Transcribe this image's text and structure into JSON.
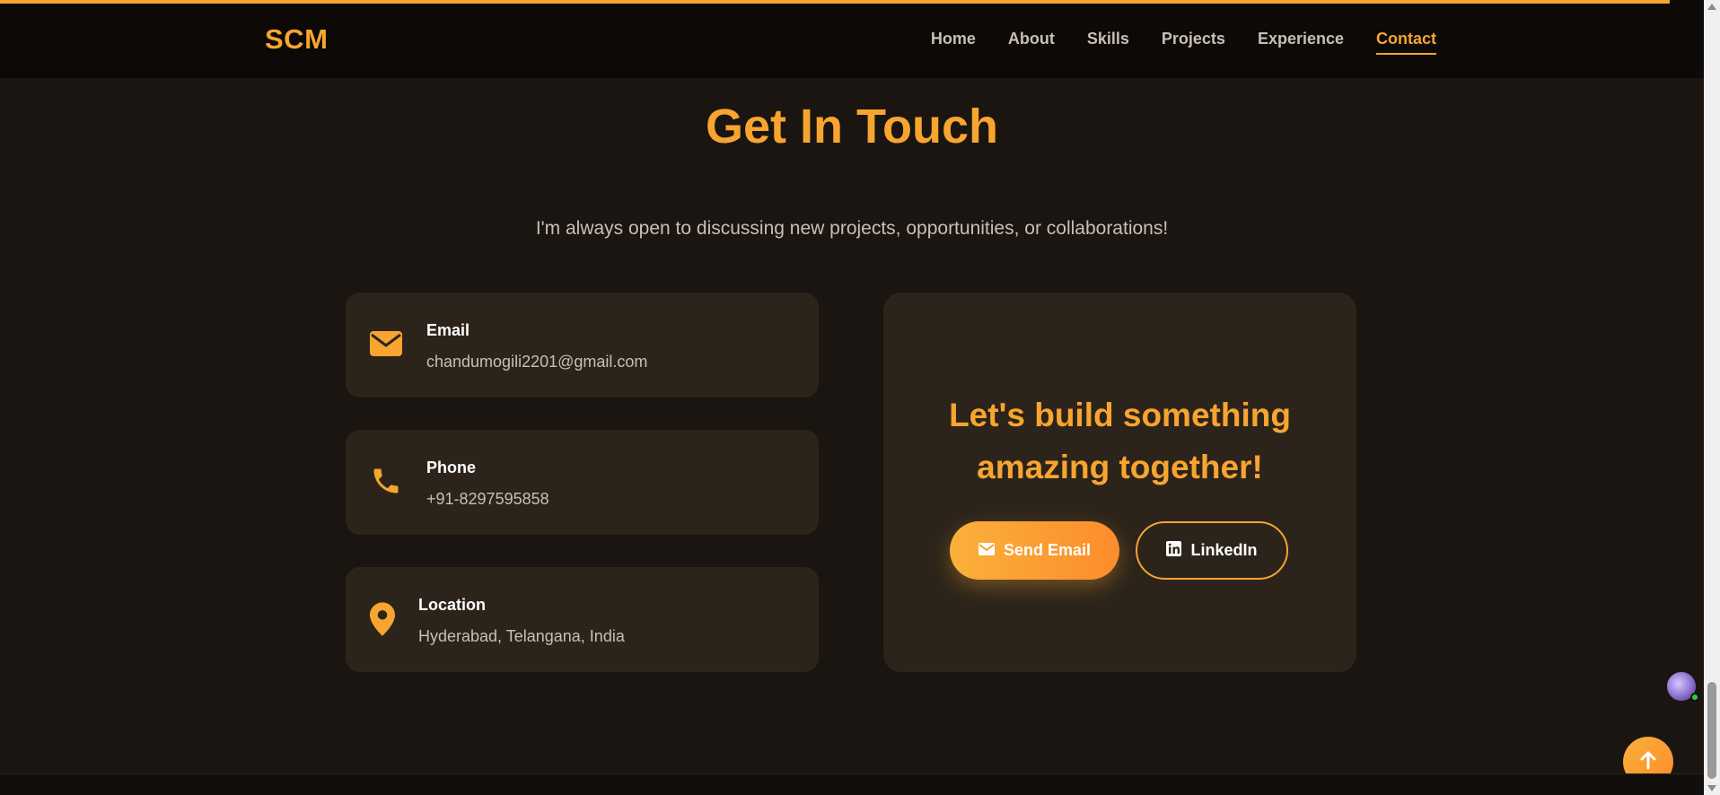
{
  "progress": {
    "percent": 98
  },
  "nav": {
    "brand": "SCM",
    "links": [
      {
        "label": "Home"
      },
      {
        "label": "About"
      },
      {
        "label": "Skills"
      },
      {
        "label": "Projects"
      },
      {
        "label": "Experience"
      },
      {
        "label": "Contact",
        "active": true
      }
    ]
  },
  "contact": {
    "title": "Get In Touch",
    "subtitle": "I'm always open to discussing new projects, opportunities, or collaborations!",
    "email": {
      "label": "Email",
      "value": "chandumogili2201@gmail.com",
      "icon": "envelope-icon"
    },
    "phone": {
      "label": "Phone",
      "value": "+91-8297595858",
      "icon": "phone-icon"
    },
    "location": {
      "label": "Location",
      "value": "Hyderabad, Telangana, India",
      "icon": "map-pin-icon"
    },
    "cta": {
      "title_line1": "Let's build something",
      "title_line2": "amazing together!",
      "send_email_label": "Send Email",
      "linkedin_label": "LinkedIn"
    }
  },
  "colors": {
    "accent": "#f7a530",
    "background": "#1a1511",
    "navbar": "#0c0907",
    "card": "#2c241a",
    "muted_text": "#c9bfb4"
  }
}
